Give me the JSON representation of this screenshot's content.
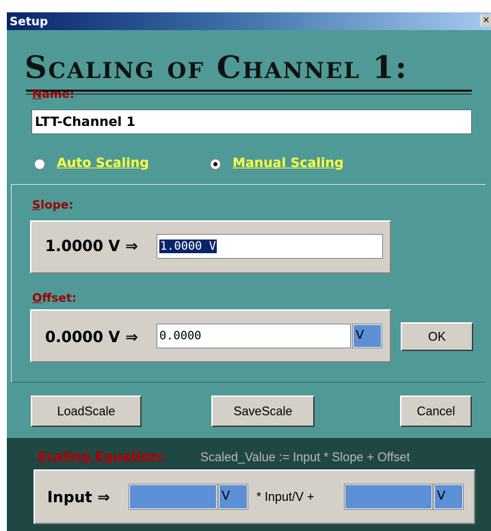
{
  "window": {
    "title": "Setup",
    "close_glyph": "×"
  },
  "heading": "Scaling of Channel 1:",
  "name_section": {
    "label_accel": "N",
    "label_rest": "ame:",
    "value": "LTT-Channel 1"
  },
  "scaling_mode": {
    "auto_label": "Auto Scaling",
    "manual_label": "Manual Scaling",
    "selected": "Manual Scaling"
  },
  "slope": {
    "label_accel": "S",
    "label_rest": "lope:",
    "prefix": "1.0000 V ⇒",
    "value": "1.0000 V"
  },
  "offset": {
    "label_accel": "O",
    "label_rest": "ffset:",
    "prefix": "0.0000 V ⇒",
    "value": "0.0000",
    "unit": "V"
  },
  "buttons": {
    "ok": "OK",
    "load": "LoadScale",
    "save": "SaveScale",
    "cancel": "Cancel"
  },
  "equation": {
    "label": "Scaling Equation:",
    "formula": "Scaled_Value := Input * Slope + Offset",
    "input_prefix": "Input ⇒",
    "unit1": "V",
    "middle": "* Input/V +",
    "unit2": "V"
  },
  "colors": {
    "background": "#4f9a96",
    "equation_background": "#1f4845",
    "label_red": "#9c0000",
    "radio_label_yellow": "#ffff40",
    "field_blue": "#5b8fd6"
  },
  "icons": {
    "close": "close-icon",
    "radio_auto": "radio-unchecked-icon",
    "radio_manual": "radio-checked-icon"
  }
}
